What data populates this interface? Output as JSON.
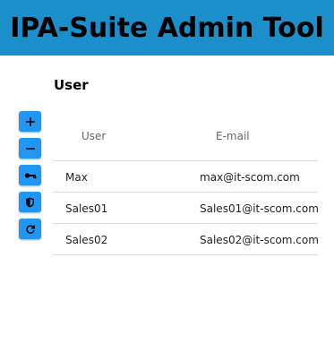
{
  "header": {
    "title": "IPA-Suite Admin Tool",
    "bg_color": "#1a8fca"
  },
  "section": {
    "title": "User"
  },
  "toolbar": {
    "accent_color": "#2196f3",
    "buttons": [
      {
        "name": "add-button",
        "icon": "plus-icon"
      },
      {
        "name": "remove-button",
        "icon": "minus-icon"
      },
      {
        "name": "key-button",
        "icon": "key-icon"
      },
      {
        "name": "shield-button",
        "icon": "shield-icon"
      },
      {
        "name": "refresh-button",
        "icon": "refresh-icon"
      }
    ]
  },
  "table": {
    "columns": [
      "User",
      "E-mail"
    ],
    "rows": [
      {
        "user": "Max",
        "email": "max@it-scom.com"
      },
      {
        "user": "Sales01",
        "email": "Sales01@it-scom.com"
      },
      {
        "user": "Sales02",
        "email": "Sales02@it-scom.com"
      }
    ]
  }
}
